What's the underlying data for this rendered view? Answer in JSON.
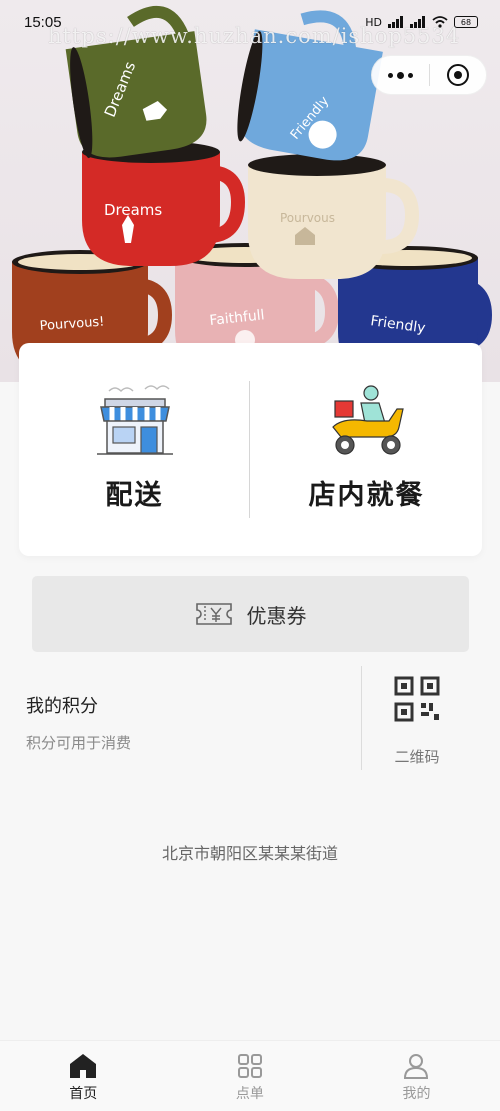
{
  "status_bar": {
    "time": "15:05",
    "network": "HD",
    "battery": "68"
  },
  "watermark": "https://www.huzhan.com/ishop5534",
  "hero": {
    "mugs": [
      {
        "color": "#5a6a2a",
        "text": "Dreams"
      },
      {
        "color": "#6fa8dc",
        "text": "Friendly"
      },
      {
        "color": "#d42a26",
        "text": "Dreams"
      },
      {
        "color": "#f1e5cf",
        "text": "Pourvous"
      },
      {
        "color": "#a1401e",
        "text": "Pourvous!"
      },
      {
        "color": "#e8b2b4",
        "text": "Faithfull"
      },
      {
        "color": "#23378f",
        "text": "Friendly"
      }
    ]
  },
  "order": {
    "delivery_label": "配送",
    "dine_in_label": "店内就餐"
  },
  "coupon": {
    "label": "优惠券"
  },
  "points": {
    "title": "我的积分",
    "subtitle": "积分可用于消费"
  },
  "qrcode": {
    "label": "二维码"
  },
  "address": "北京市朝阳区某某某街道",
  "tabs": [
    {
      "label": "首页",
      "icon": "home-icon",
      "active": true
    },
    {
      "label": "点单",
      "icon": "grid-icon",
      "active": false
    },
    {
      "label": "我的",
      "icon": "user-icon",
      "active": false
    }
  ],
  "colors": {
    "accent": "#222222",
    "inactive": "#999999",
    "scooter": "#f5b800"
  }
}
